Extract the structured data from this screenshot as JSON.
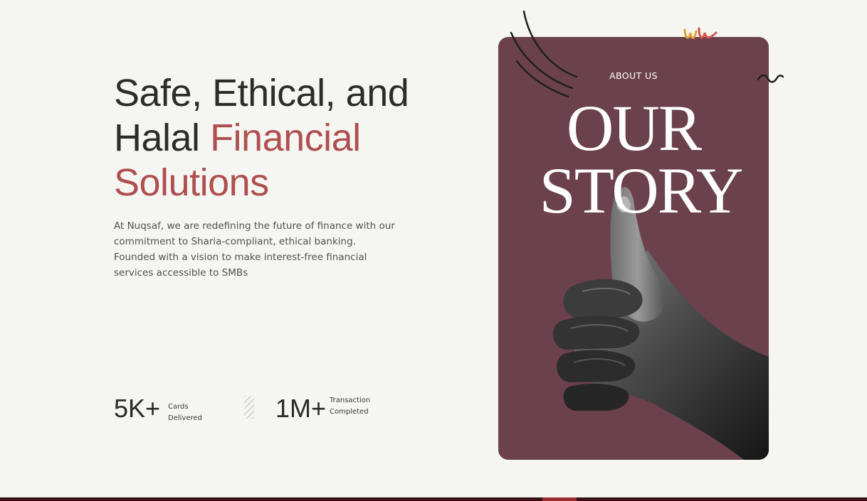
{
  "hero": {
    "title_line1": "Safe, Ethical, and",
    "title_line2_plain": "Halal ",
    "title_line2_accent": "Financial",
    "title_line3_accent": "Solutions",
    "description": "At Nuqsaf, we are redefining the future of finance with our commitment to Sharia-compliant, ethical banking. Founded with a vision to make interest-free financial services accessible to SMBs"
  },
  "stats": [
    {
      "value": "5K+",
      "label_line1": "Cards Delivered",
      "label_line2": ""
    },
    {
      "value": "1M+",
      "label_line1": "Transaction",
      "label_line2": "Completed"
    }
  ],
  "card": {
    "eyebrow": "ABOUT US",
    "title_line1": "OUR",
    "title_line2": "STORY"
  },
  "colors": {
    "background": "#f5f6f1",
    "text": "#2c2c2c",
    "accent": "#b04f4f",
    "card": "#6b414d",
    "footer": "#3b1014",
    "footer_mark": "#9a2f2f"
  },
  "icons": [
    "thumbs-up-hand-image",
    "arc-lines-decoration",
    "squiggle-decoration",
    "wave-decoration"
  ]
}
